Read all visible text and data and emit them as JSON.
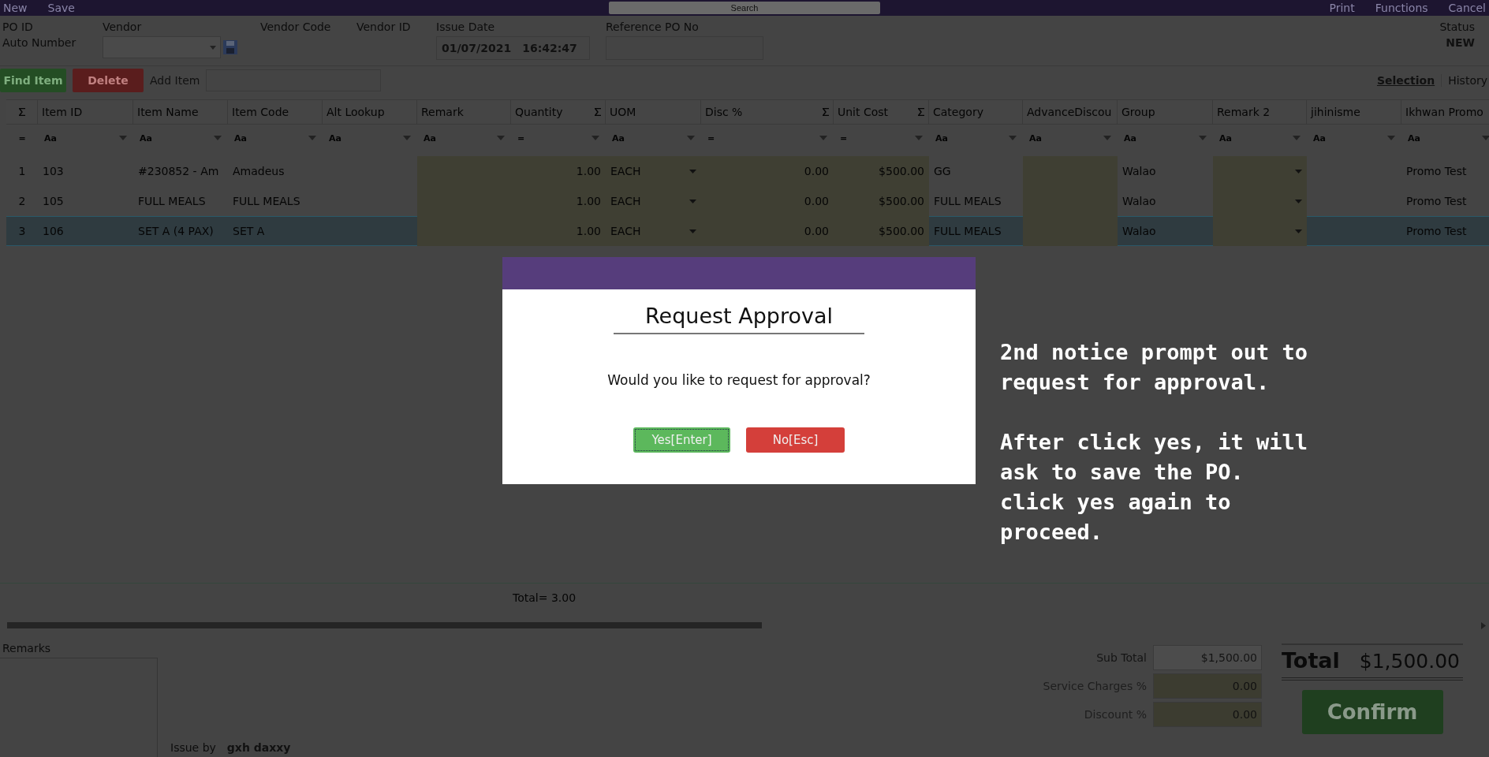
{
  "top_bar": {
    "actions_left": [
      "New",
      "Save"
    ],
    "search": {
      "placeholder": "Search"
    },
    "actions_right": [
      "Print",
      "Functions",
      "Cancel"
    ]
  },
  "header": {
    "po_id_label": "PO ID",
    "po_id_value": "Auto Number",
    "vendor_label": "Vendor",
    "vendor_code_label": "Vendor Code",
    "vendor_id_label": "Vendor ID",
    "issue_date_label": "Issue Date",
    "issue_date": "01/07/2021",
    "issue_time": "16:42:47",
    "reference_label": "Reference PO No",
    "status_label": "Status",
    "status_value": "NEW"
  },
  "toolbar": {
    "find_button": "Find Item",
    "delete_button": "Delete",
    "add_item_label": "Add Item",
    "links": [
      {
        "label": "Selection",
        "selected": true
      },
      {
        "label": "History",
        "selected": false
      }
    ]
  },
  "table": {
    "columns": [
      {
        "kind": "index",
        "sigma": true,
        "filter": "=",
        "editable": false,
        "dropdown": false
      },
      {
        "label": "Item ID",
        "kind": "text",
        "sigma": false,
        "filter": "Aa",
        "editable": false,
        "dropdown": false
      },
      {
        "label": "Item Name",
        "kind": "text",
        "sigma": false,
        "filter": "Aa",
        "editable": false,
        "dropdown": false
      },
      {
        "label": "Item Code",
        "kind": "text",
        "sigma": false,
        "filter": "Aa",
        "editable": false,
        "dropdown": false
      },
      {
        "label": "Alt Lookup",
        "kind": "text",
        "sigma": false,
        "filter": "Aa",
        "editable": false,
        "dropdown": false
      },
      {
        "label": "Remark",
        "kind": "text",
        "sigma": false,
        "filter": "Aa",
        "editable": true,
        "dropdown": false
      },
      {
        "label": "Quantity",
        "kind": "number",
        "sigma": true,
        "filter": "=",
        "editable": true,
        "dropdown": false
      },
      {
        "label": "UOM",
        "kind": "text",
        "sigma": false,
        "filter": "Aa",
        "editable": true,
        "dropdown": true
      },
      {
        "label": "Disc %",
        "kind": "number",
        "sigma": true,
        "filter": "=",
        "editable": true,
        "dropdown": false
      },
      {
        "label": "Unit Cost",
        "kind": "number",
        "sigma": true,
        "filter": "=",
        "editable": true,
        "dropdown": false
      },
      {
        "label": "Category",
        "kind": "text",
        "sigma": false,
        "filter": "Aa",
        "editable": false,
        "dropdown": false
      },
      {
        "label": "AdvanceDiscou",
        "kind": "text",
        "sigma": false,
        "filter": "Aa",
        "editable": true,
        "dropdown": false
      },
      {
        "label": "Group",
        "kind": "text",
        "sigma": false,
        "filter": "Aa",
        "editable": false,
        "dropdown": false
      },
      {
        "label": "Remark 2",
        "kind": "text",
        "sigma": false,
        "filter": "Aa",
        "editable": true,
        "dropdown": true
      },
      {
        "label": "jihinisme",
        "kind": "text",
        "sigma": false,
        "filter": "Aa",
        "editable": false,
        "dropdown": false
      },
      {
        "label": "Ikhwan Promo",
        "kind": "text",
        "sigma": false,
        "filter": "Aa",
        "editable": false,
        "dropdown": false
      }
    ],
    "rows": [
      {
        "selected": false,
        "cells": [
          "1",
          "103",
          "#230852 - Am",
          "Amadeus",
          null,
          null,
          "1.00",
          "EACH",
          "0.00",
          "$500.00",
          "GG",
          null,
          "Walao",
          null,
          null,
          "Promo Test"
        ]
      },
      {
        "selected": false,
        "cells": [
          "2",
          "105",
          "FULL MEALS",
          "FULL MEALS",
          null,
          null,
          "1.00",
          "EACH",
          "0.00",
          "$500.00",
          "FULL MEALS",
          null,
          "Walao",
          null,
          null,
          "Promo Test"
        ]
      },
      {
        "selected": true,
        "cells": [
          "3",
          "106",
          "SET A (4 PAX)",
          "SET A",
          null,
          null,
          "1.00",
          "EACH",
          "0.00",
          "$500.00",
          "FULL MEALS",
          null,
          "Walao",
          null,
          null,
          "Promo Test"
        ]
      }
    ],
    "summary": "Total= 3.00"
  },
  "footer": {
    "remarks_label": "Remarks",
    "issue_by_label": "Issue by",
    "issue_by_value": "gxh daxxy",
    "amounts": [
      {
        "label": "Sub Total",
        "value": "$1,500.00",
        "editable": false
      },
      {
        "label": "Service Charges %",
        "value": "0.00",
        "editable": true
      },
      {
        "label": "Discount %",
        "value": "0.00",
        "editable": true
      }
    ],
    "total_label": "Total",
    "total_value": "$1,500.00",
    "confirm_button": "Confirm"
  },
  "dialog": {
    "title": "Request Approval",
    "message": "Would you like to request for approval?",
    "buttons": [
      {
        "label": "Yes[Enter]",
        "kind": "confirm"
      },
      {
        "label": "No[Esc]",
        "kind": "cancel"
      }
    ]
  },
  "annotation": {
    "paragraphs": [
      [
        "2nd notice prompt out to",
        "request for approval."
      ],
      [
        "After click yes, it will",
        "ask to save the PO.",
        "click yes again to",
        "proceed."
      ]
    ]
  }
}
